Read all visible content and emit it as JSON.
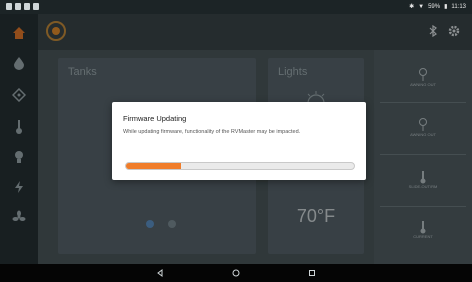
{
  "statusbar": {
    "battery": "59%",
    "time": "11:13"
  },
  "tanks": {
    "title": "Tanks"
  },
  "lights": {
    "title": "Lights"
  },
  "temperature": {
    "value": "70°F"
  },
  "controls": [
    {
      "label": "AWNING OUT"
    },
    {
      "label": "AWNING OUT"
    },
    {
      "label": "SLIDE-OUT/RM"
    },
    {
      "label": "CURRENT"
    }
  ],
  "dialog": {
    "title": "Firmware Updating",
    "message": "While updating firmware, functionality of the RVMaster may be impacted.",
    "progress": 0.24
  },
  "colors": {
    "accent": "#f07d2a",
    "sidebar_active": "#e0772a"
  }
}
